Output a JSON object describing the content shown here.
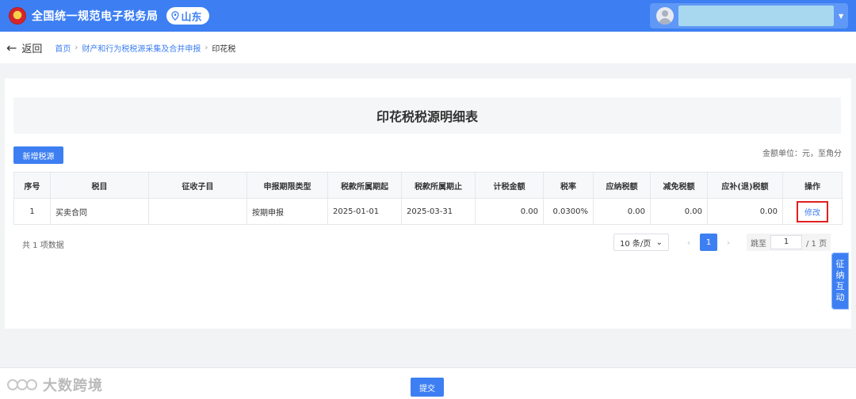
{
  "header": {
    "title": "全国统一规范电子税务局",
    "region": "山东"
  },
  "nav": {
    "back_label": "返回",
    "breadcrumbs": [
      "首页",
      "财产和行为税税源采集及合并申报"
    ],
    "current": "印花税"
  },
  "page": {
    "title": "印花税税源明细表",
    "add_button": "新增税源",
    "unit_note": "金额单位：元，至角分"
  },
  "table": {
    "columns": [
      "序号",
      "税目",
      "征收子目",
      "申报期限类型",
      "税款所属期起",
      "税款所属期止",
      "计税金额",
      "税率",
      "应纳税额",
      "减免税额",
      "应补(退)税额",
      "操作"
    ],
    "rows": [
      {
        "index": "1",
        "tax_item": "买卖合同",
        "sub_item": "",
        "period_type": "按期申报",
        "period_start": "2025-01-01",
        "period_end": "2025-03-31",
        "taxable_amount": "0.00",
        "rate": "0.0300%",
        "tax_payable": "0.00",
        "tax_relief": "0.00",
        "tax_due": "0.00",
        "action": "修改"
      }
    ]
  },
  "pagination": {
    "total_text": "共 1 项数据",
    "page_size": "10 条/页",
    "current_page": "1",
    "jump_label": "跳至",
    "jump_value": "1",
    "total_pages": "/ 1 页"
  },
  "side_tab": [
    "征",
    "纳",
    "互",
    "动"
  ],
  "footer": {
    "submit": "提交",
    "watermark": "大数跨境"
  },
  "colors": {
    "primary": "#3d7ff2",
    "highlight_border": "#e0201f"
  }
}
